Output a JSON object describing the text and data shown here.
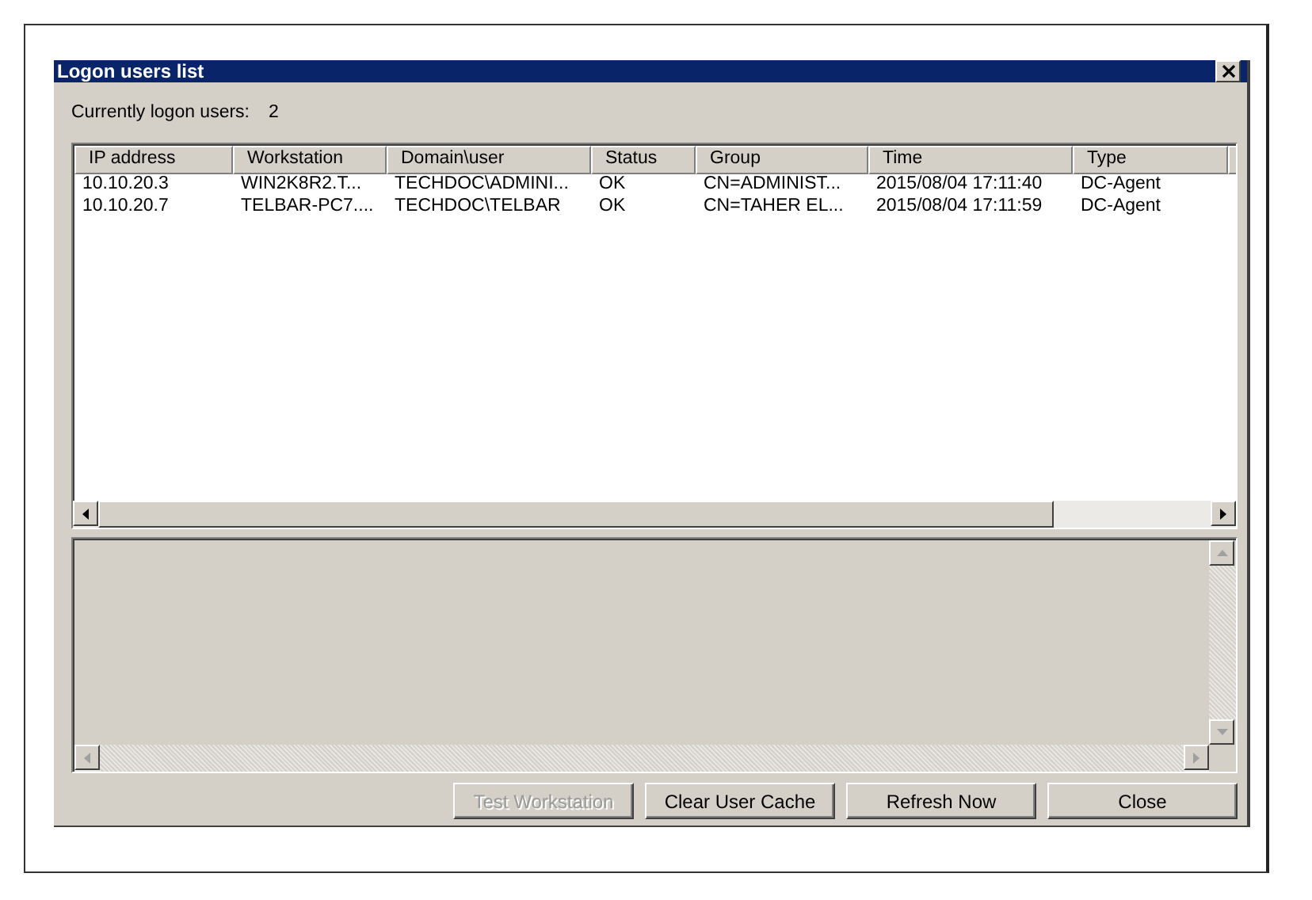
{
  "window": {
    "title": "Logon users list"
  },
  "summary": {
    "label": "Currently logon users:",
    "count": "2"
  },
  "table": {
    "columns": [
      "IP address",
      "Workstation",
      "Domain\\user",
      "Status",
      "Group",
      "Time",
      "Type"
    ],
    "rows": [
      [
        "10.10.20.3",
        "WIN2K8R2.T...",
        "TECHDOC\\ADMINI...",
        "OK",
        "CN=ADMINIST...",
        "2015/08/04 17:11:40",
        "DC-Agent"
      ],
      [
        "10.10.20.7",
        "TELBAR-PC7....",
        "TECHDOC\\TELBAR",
        "OK",
        "CN=TAHER EL...",
        "2015/08/04 17:11:59",
        "DC-Agent"
      ]
    ]
  },
  "buttons": [
    {
      "label": "Test Workstation",
      "disabled": true
    },
    {
      "label": "Clear User Cache",
      "disabled": false
    },
    {
      "label": "Refresh Now",
      "disabled": false
    },
    {
      "label": "Close",
      "disabled": false
    }
  ]
}
